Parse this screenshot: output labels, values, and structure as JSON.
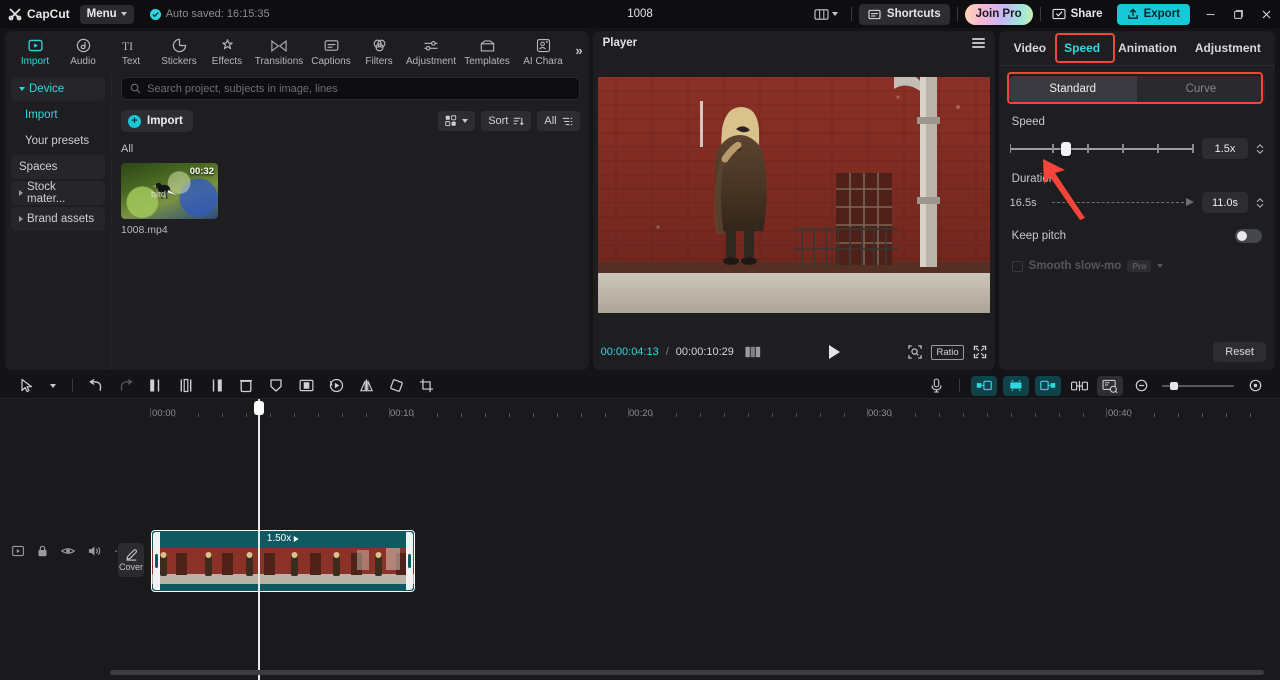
{
  "titlebar": {
    "brand": "CapCut",
    "menu_label": "Menu",
    "autosave": "Auto saved: 16:15:35",
    "project_title": "1008",
    "shortcuts_label": "Shortcuts",
    "join_pro_label": "Join Pro",
    "share_label": "Share",
    "export_label": "Export",
    "layout_icon": "layout-icon",
    "minimize_icon": "minimize-icon",
    "maximize_icon": "maximize-icon",
    "close_icon": "close-icon"
  },
  "modules": [
    {
      "label": "Import",
      "icon": "import-icon",
      "active": true
    },
    {
      "label": "Audio",
      "icon": "audio-icon",
      "active": false
    },
    {
      "label": "Text",
      "icon": "text-icon",
      "active": false
    },
    {
      "label": "Stickers",
      "icon": "stickers-icon",
      "active": false
    },
    {
      "label": "Effects",
      "icon": "effects-icon",
      "active": false
    },
    {
      "label": "Transitions",
      "icon": "transitions-icon",
      "active": false
    },
    {
      "label": "Captions",
      "icon": "captions-icon",
      "active": false
    },
    {
      "label": "Filters",
      "icon": "filters-icon",
      "active": false
    },
    {
      "label": "Adjustment",
      "icon": "adjustment-icon",
      "active": false
    },
    {
      "label": "Templates",
      "icon": "templates-icon",
      "active": false
    },
    {
      "label": "AI Chara",
      "icon": "ai-character-icon",
      "active": false
    }
  ],
  "modules_more": "»",
  "sidebar": {
    "items": [
      {
        "label": "Device",
        "type": "group",
        "teal": true
      },
      {
        "label": "Import",
        "type": "sub",
        "teal": true
      },
      {
        "label": "Your presets",
        "type": "sub",
        "teal": false
      },
      {
        "label": "Spaces",
        "type": "group-plain",
        "teal": false
      },
      {
        "label": "Stock mater...",
        "type": "group",
        "teal": false
      },
      {
        "label": "Brand assets",
        "type": "group",
        "teal": false
      }
    ]
  },
  "media": {
    "search_placeholder": "Search project, subjects in image, lines",
    "import_label": "Import",
    "view_label": "",
    "sort_label": "Sort",
    "filter_label": "All",
    "section_label": "All",
    "items": [
      {
        "name": "1008.mp4",
        "duration": "00:32",
        "tag": "bird"
      }
    ]
  },
  "player": {
    "title": "Player",
    "menu_icon": "hamburger-icon",
    "current_time": "00:00:04:13",
    "separator": "/",
    "total_time": "00:00:10:29",
    "frames_icon": "frames-icon",
    "play_icon": "play-icon",
    "magnify_icon": "magnify-icon",
    "ratio_label": "Ratio",
    "fullscreen_icon": "fullscreen-icon",
    "caption": "-"
  },
  "properties": {
    "tabs": [
      {
        "label": "Video",
        "active": false
      },
      {
        "label": "Speed",
        "active": true
      },
      {
        "label": "Animation",
        "active": false
      },
      {
        "label": "Adjustment",
        "active": false
      }
    ],
    "tabs_more": "≫",
    "mode": {
      "standard": "Standard",
      "curve": "Curve",
      "selected": "Standard"
    },
    "speed_label": "Speed",
    "speed_value": "1.5x",
    "speed_slider_percent": 23,
    "duration_label": "Duration",
    "duration_from": "16.5s",
    "duration_to": "11.0s",
    "keep_pitch_label": "Keep pitch",
    "keep_pitch_on": false,
    "smooth_label": "Smooth slow-mo",
    "pro_badge": "Pro",
    "reset_label": "Reset"
  },
  "timeline": {
    "tools": [
      {
        "name": "select-tool-icon"
      },
      {
        "name": "chevron-down-icon"
      },
      {
        "name": "undo-icon"
      },
      {
        "name": "redo-icon"
      },
      {
        "name": "split-left-icon"
      },
      {
        "name": "split-icon"
      },
      {
        "name": "split-right-icon"
      },
      {
        "name": "delete-icon"
      },
      {
        "name": "freeze-icon"
      },
      {
        "name": "mirror-split-icon"
      },
      {
        "name": "reverse-icon"
      },
      {
        "name": "flip-icon"
      },
      {
        "name": "rotate-icon"
      },
      {
        "name": "crop-icon"
      }
    ],
    "right_tools": [
      {
        "name": "microphone-icon"
      },
      {
        "name": "auto-cut-left-icon"
      },
      {
        "name": "auto-cut-mid-icon"
      },
      {
        "name": "auto-cut-right-icon"
      },
      {
        "name": "link-icon"
      },
      {
        "name": "preview-icon"
      },
      {
        "name": "zoom-out-icon"
      },
      {
        "name": "zoom-in-icon"
      }
    ],
    "ruler_labels": [
      "00:00",
      "00:10",
      "00:20",
      "00:30",
      "00:40"
    ],
    "track_controls": [
      {
        "name": "track-type-icon"
      },
      {
        "name": "lock-icon"
      },
      {
        "name": "eye-icon"
      },
      {
        "name": "volume-icon"
      },
      {
        "name": "more-icon"
      }
    ],
    "cover_label": "Cover",
    "cover_icon": "pencil-icon",
    "clip": {
      "speed_label": "1.50x",
      "play_icon": "play-small-icon"
    }
  },
  "colors": {
    "accent": "#2fd8e0",
    "annotation": "#f5443a",
    "clip_teal": "#0e5a60"
  }
}
